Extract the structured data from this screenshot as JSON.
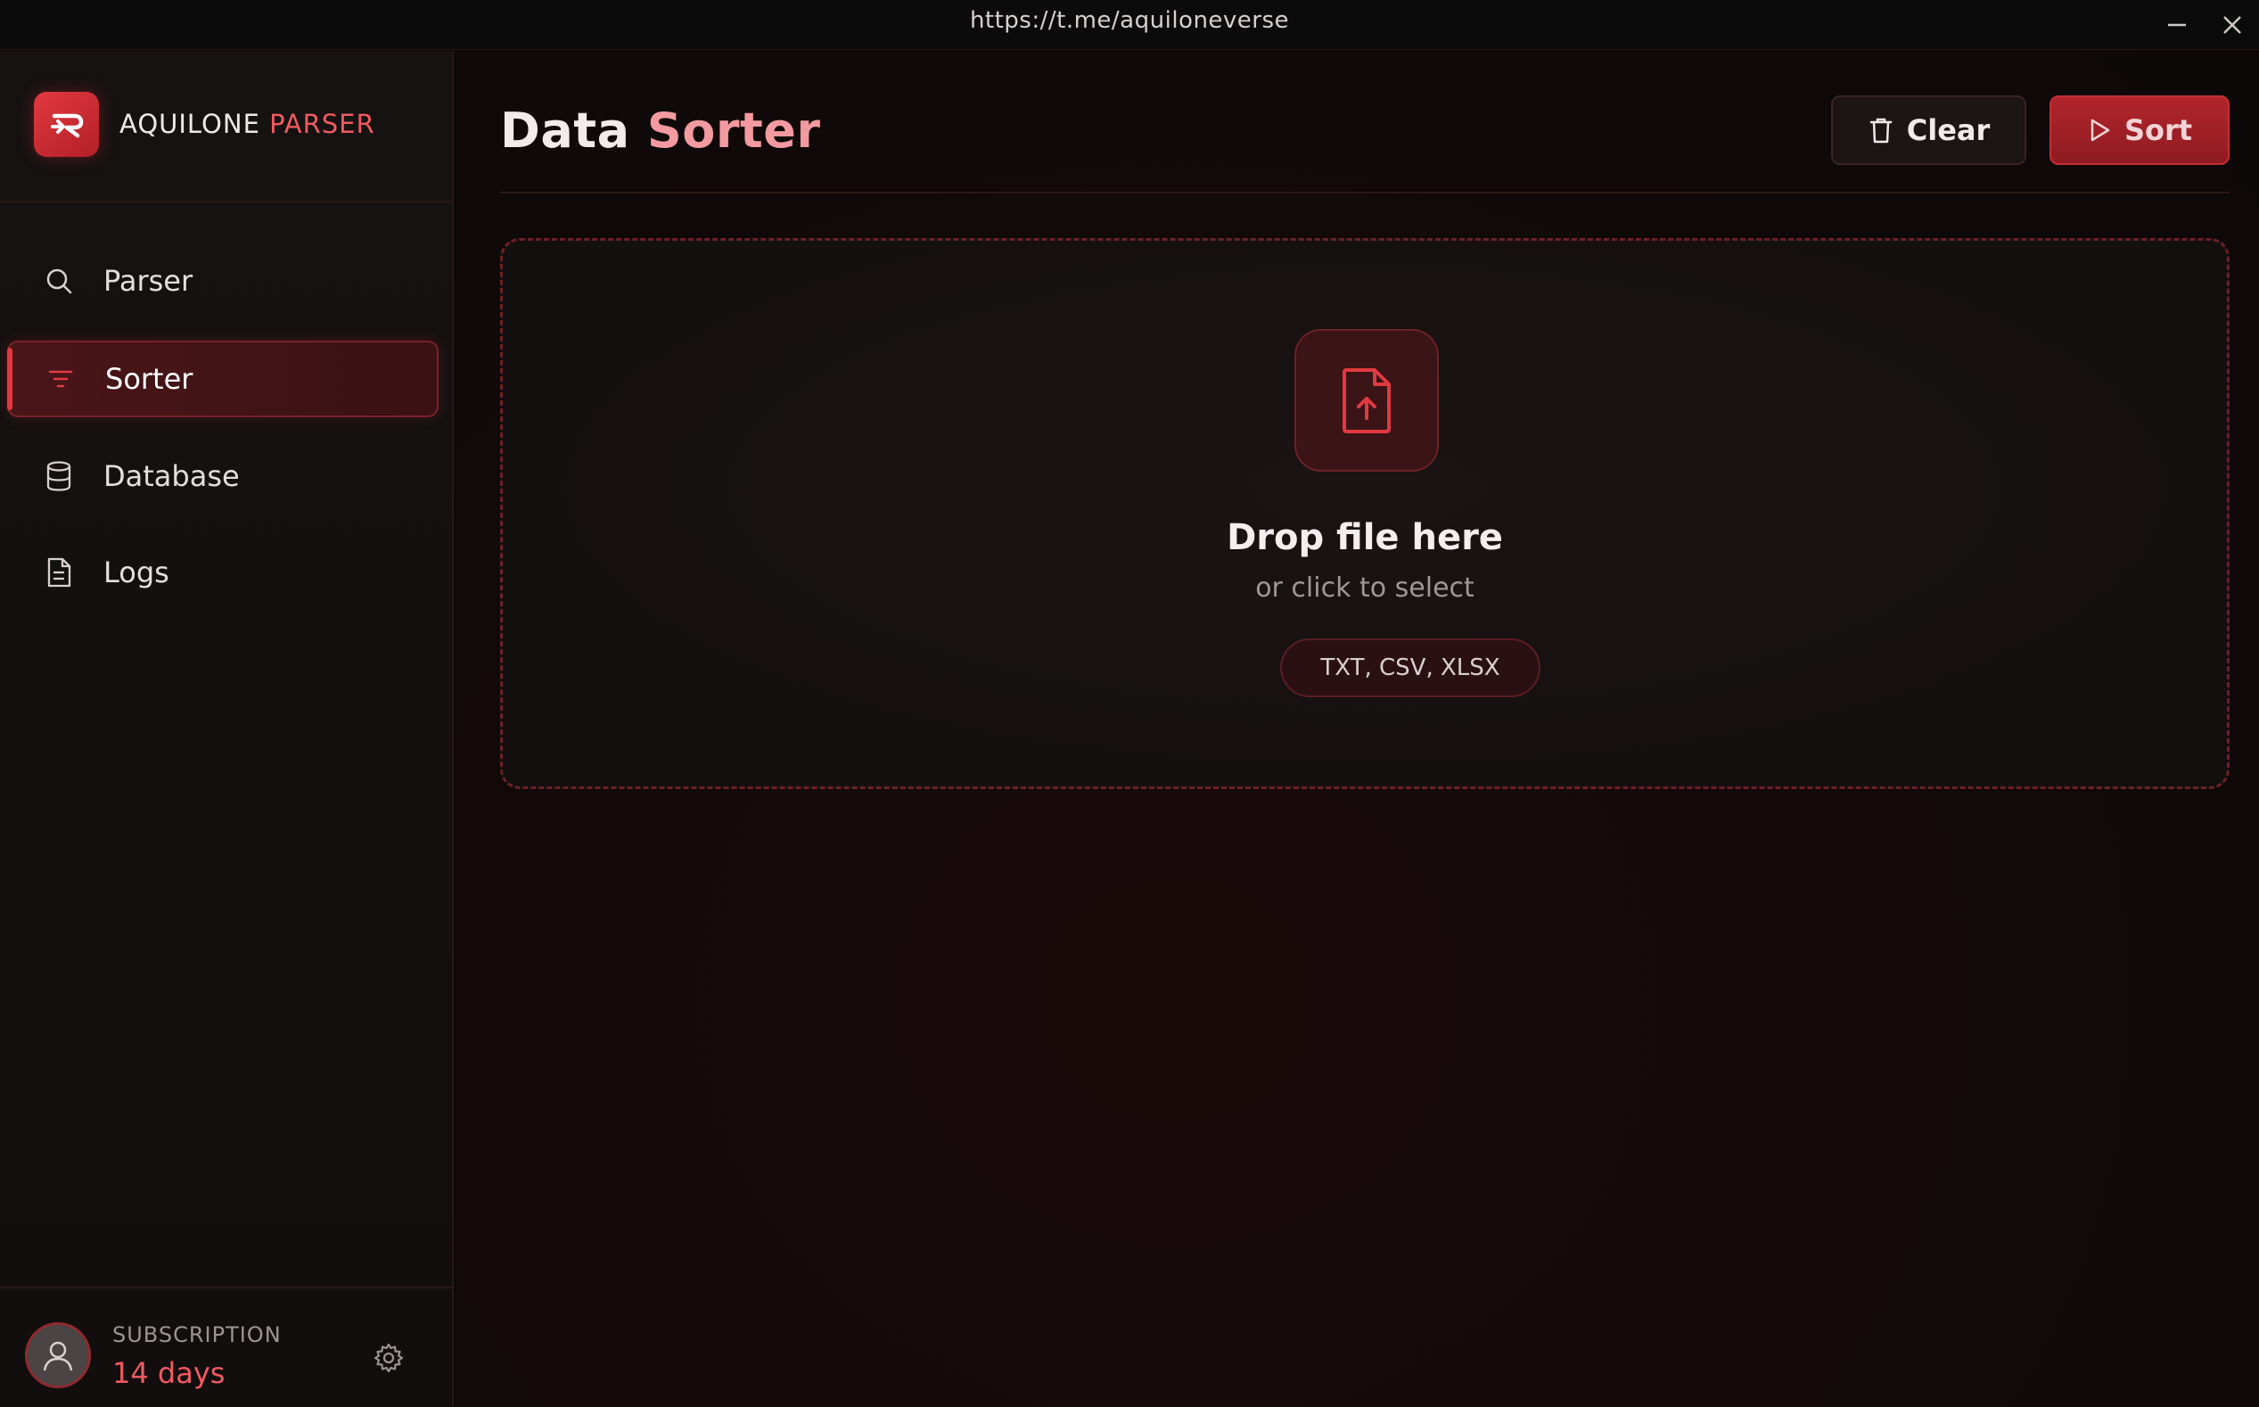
{
  "window": {
    "url": "https://t.me/aquiloneverse"
  },
  "brand": {
    "name_part1": "AQUILONE",
    "name_part2": "PARSER"
  },
  "sidebar": {
    "items": [
      {
        "label": "Parser",
        "icon": "search-icon",
        "active": false
      },
      {
        "label": "Sorter",
        "icon": "filter-icon",
        "active": true
      },
      {
        "label": "Database",
        "icon": "database-icon",
        "active": false
      },
      {
        "label": "Logs",
        "icon": "file-text-icon",
        "active": false
      }
    ]
  },
  "subscription": {
    "label": "SUBSCRIPTION",
    "value": "14 days"
  },
  "header": {
    "title_part1": "Data",
    "title_part2": "Sorter",
    "clear_label": "Clear",
    "sort_label": "Sort"
  },
  "dropzone": {
    "title": "Drop file here",
    "subtitle": "or click to select",
    "formats": "TXT, CSV, XLSX"
  },
  "colors": {
    "accent": "#e03a40",
    "accent_text": "#f05a60",
    "title_highlight": "#f39aa0"
  }
}
